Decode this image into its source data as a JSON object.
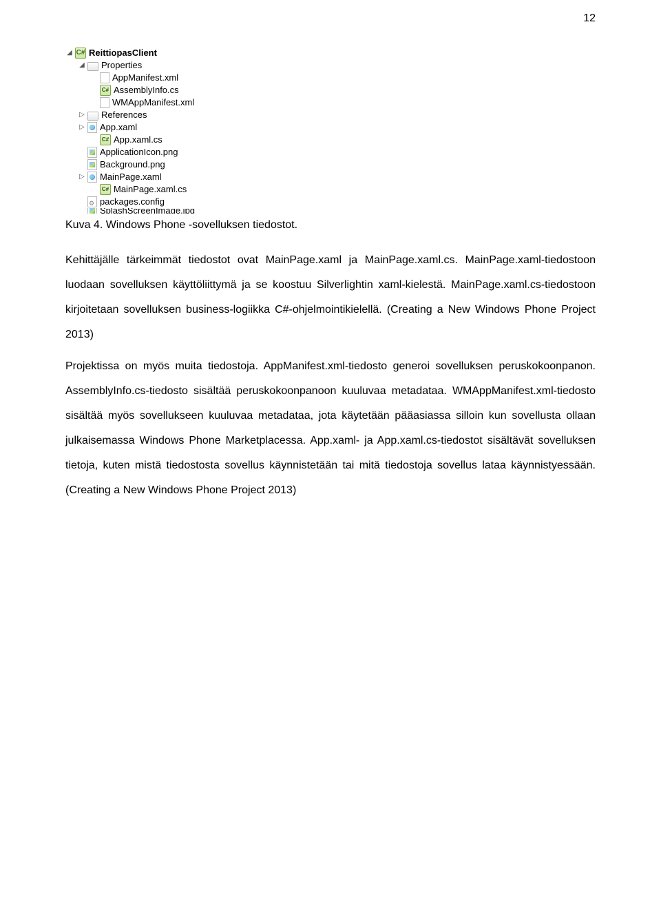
{
  "pageNumber": "12",
  "tree": {
    "root": {
      "label": "ReittiopasClient"
    },
    "properties": {
      "label": "Properties"
    },
    "items_props": [
      {
        "label": "AppManifest.xml"
      },
      {
        "label": "AssemblyInfo.cs"
      },
      {
        "label": "WMAppManifest.xml"
      }
    ],
    "references": {
      "label": "References"
    },
    "items_root": [
      {
        "label": "App.xaml"
      },
      {
        "label": "App.xaml.cs"
      },
      {
        "label": "ApplicationIcon.png"
      },
      {
        "label": "Background.png"
      },
      {
        "label": "MainPage.xaml"
      },
      {
        "label": "MainPage.xaml.cs"
      },
      {
        "label": "packages.config"
      },
      {
        "label": "SplashScreenImage.jpg"
      }
    ],
    "cs_glyph": "C#"
  },
  "caption": "Kuva 4. Windows Phone -sovelluksen tiedostot.",
  "para1": "Kehittäjälle tärkeimmät tiedostot ovat MainPage.xaml ja MainPage.xaml.cs. MainPage.xaml-tiedostoon luodaan sovelluksen käyttöliittymä ja se koostuu Silverlightin xaml-kielestä. MainPage.xaml.cs-tiedostoon kirjoitetaan sovelluksen business-logiikka C#-ohjelmointikielellä. (Creating a New Windows Phone Project 2013)",
  "para2": "Projektissa on myös muita tiedostoja. AppManifest.xml-tiedosto generoi sovelluksen peruskokoonpanon. AssemblyInfo.cs-tiedosto sisältää peruskokoonpanoon kuuluvaa metadataa. WMAppManifest.xml-tiedosto sisältää myös sovellukseen kuuluvaa metadataa, jota käytetään pääasiassa silloin kun sovellusta ollaan julkaisemassa Windows Phone Marketplacessa. App.xaml- ja App.xaml.cs-tiedostot sisältävät sovelluksen tietoja, kuten mistä tiedostosta sovellus käynnistetään tai mitä tiedostoja sovellus lataa käynnistyessään. (Creating a New Windows Phone Project 2013)"
}
